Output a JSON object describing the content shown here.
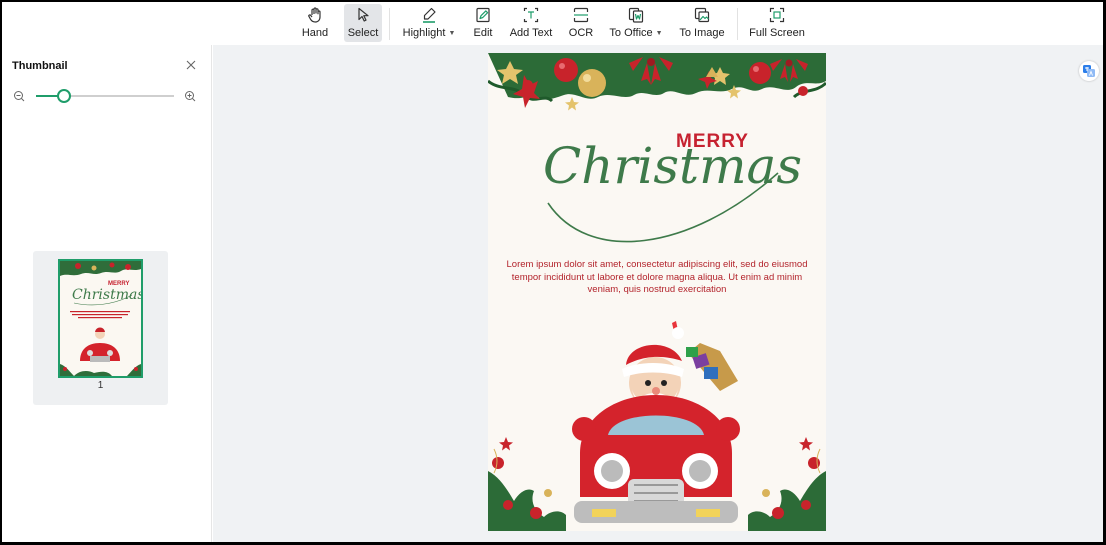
{
  "toolbar": {
    "hand": "Hand",
    "select": "Select",
    "highlight": "Highlight",
    "edit": "Edit",
    "add_text": "Add Text",
    "ocr": "OCR",
    "to_office": "To Office",
    "to_image": "To Image",
    "full_screen": "Full Screen"
  },
  "sidebar": {
    "title": "Thumbnail",
    "zoom_level": 0.2,
    "thumbnails": [
      {
        "page": "1",
        "selected": true
      }
    ]
  },
  "document": {
    "merry": "MERRY",
    "christmas": "Christmas",
    "body": "Lorem ipsum dolor sit amet, consectetur adipiscing elit, sed do eiusmod tempor incididunt ut labore et dolore magna aliqua. Ut enim ad minim veniam, quis nostrud exercitation"
  },
  "icons": {
    "hand": "hand-icon",
    "select": "cursor-icon",
    "highlight": "highlighter-icon",
    "edit": "edit-icon",
    "add_text": "add-text-icon",
    "ocr": "ocr-icon",
    "to_office": "to-office-icon",
    "to_image": "to-image-icon",
    "full_screen": "full-screen-icon",
    "translate": "translate-icon"
  },
  "colors": {
    "accent": "#1f9d6a",
    "active_tool_bg": "#e3e5e8",
    "canvas_bg": "#f0f2f4",
    "merry_red": "#c62230",
    "christmas_green": "#3e7a4a"
  }
}
